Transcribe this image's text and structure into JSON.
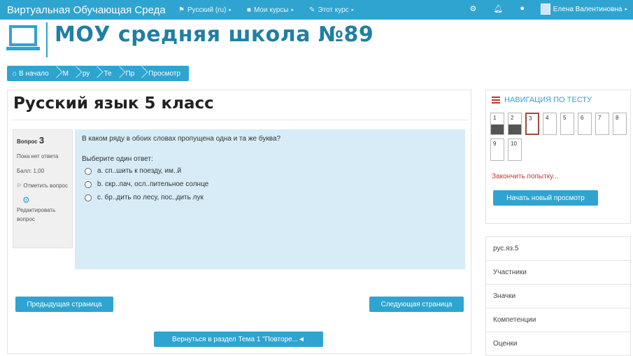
{
  "navbar": {
    "brand": "Виртуальная Обучающая Среда",
    "language": "Русский (ru)",
    "my_courses": "Мои курсы",
    "this_course": "Этот курс",
    "user_name": "Елена Валентиновна",
    "icons": [
      "gear-icon",
      "bell-icon",
      "chat-icon"
    ]
  },
  "header": {
    "school_name": "МОУ средняя школа №89"
  },
  "breadcrumb": [
    "В начало",
    "М",
    "ру",
    "Те",
    "Пр",
    "Просмотр"
  ],
  "main": {
    "course_title": "Русский язык 5 класс",
    "question_info": {
      "label": "Вопрос",
      "number": "3",
      "status": "Пока нет ответа",
      "points": "Балл: 1,00",
      "flag": "Отметить вопрос",
      "edit": "Редактировать вопрос"
    },
    "question": {
      "text": "В каком ряду в обоих словах пропущена одна и та же буква?",
      "prompt": "Выберите один ответ:",
      "options": [
        "a. сп..шить к поезду, им..й",
        "b. скр..пач, осл..пительное солнце",
        "c. бр..дить по лесу, пос..дить лук"
      ]
    },
    "buttons": {
      "prev": "Предыдущая страница",
      "next": "Следующая страница",
      "back": "Вернуться в раздел Тема 1 \"Повторе...◄"
    }
  },
  "quiz_nav": {
    "title": "НАВИГАЦИЯ ПО ТЕСТУ",
    "tiles": [
      "1",
      "2",
      "3",
      "4",
      "5",
      "6",
      "7",
      "8",
      "9",
      "10"
    ],
    "finish_link": "Закончить попытку...",
    "new_preview": "Начать новый просмотр"
  },
  "block_list": [
    "рус.яз.5",
    "Участники",
    "Значки",
    "Компетенции",
    "Оценки"
  ],
  "colors": {
    "primary": "#2fa4d0",
    "question_bg": "#d7ecf6",
    "title": "#1f7fa5",
    "link_red": "#c0392b"
  }
}
